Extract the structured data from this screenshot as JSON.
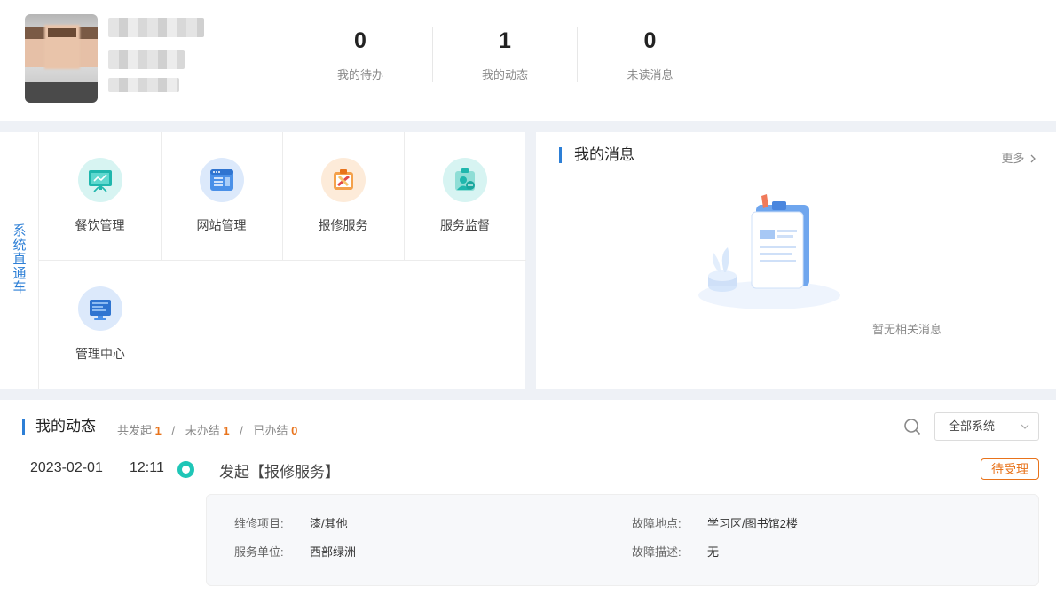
{
  "stats": [
    {
      "value": "0",
      "label": "我的待办"
    },
    {
      "value": "1",
      "label": "我的动态"
    },
    {
      "value": "0",
      "label": "未读消息"
    }
  ],
  "quick": {
    "tab_label": "系统直通车",
    "tiles": [
      {
        "label": "餐饮管理",
        "icon": "dining-management-icon"
      },
      {
        "label": "网站管理",
        "icon": "website-management-icon"
      },
      {
        "label": "报修服务",
        "icon": "repair-service-icon"
      },
      {
        "label": "服务监督",
        "icon": "service-supervision-icon"
      },
      {
        "label": "管理中心",
        "icon": "management-center-icon"
      }
    ]
  },
  "messages": {
    "title": "我的消息",
    "more_label": "更多",
    "empty_text": "暂无相关消息"
  },
  "activity": {
    "title": "我的动态",
    "counts": {
      "total_label": "共发起",
      "total": "1",
      "pending_label": "未办结",
      "pending": "1",
      "done_label": "已办结",
      "done": "0",
      "separator": "/"
    },
    "filter_value": "全部系统",
    "item": {
      "date": "2023-02-01",
      "time": "12:11",
      "text": "发起【报修服务】",
      "status": "待受理",
      "fields": {
        "item_label": "维修项目:",
        "item_value": "漆/其他",
        "location_label": "故障地点:",
        "location_value": "学习区/图书馆2楼",
        "unit_label": "服务单位:",
        "unit_value": "西部绿洲",
        "desc_label": "故障描述:",
        "desc_value": "无"
      }
    }
  },
  "colors": {
    "accent": "#2d7fd6",
    "highlight": "#e8731b",
    "timeline_dot": "#1fc6b7"
  }
}
